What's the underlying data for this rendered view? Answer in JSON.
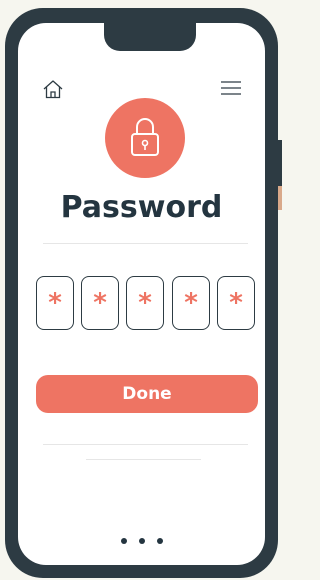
{
  "screen": {
    "title": "Password",
    "pin": [
      "*",
      "*",
      "*",
      "*",
      "*"
    ],
    "done_label": "Done"
  },
  "colors": {
    "accent": "#ee7463",
    "phone_frame": "#2d3b43",
    "text_dark": "#243540"
  },
  "icons": [
    "home-icon",
    "menu-icon",
    "lock-icon"
  ]
}
